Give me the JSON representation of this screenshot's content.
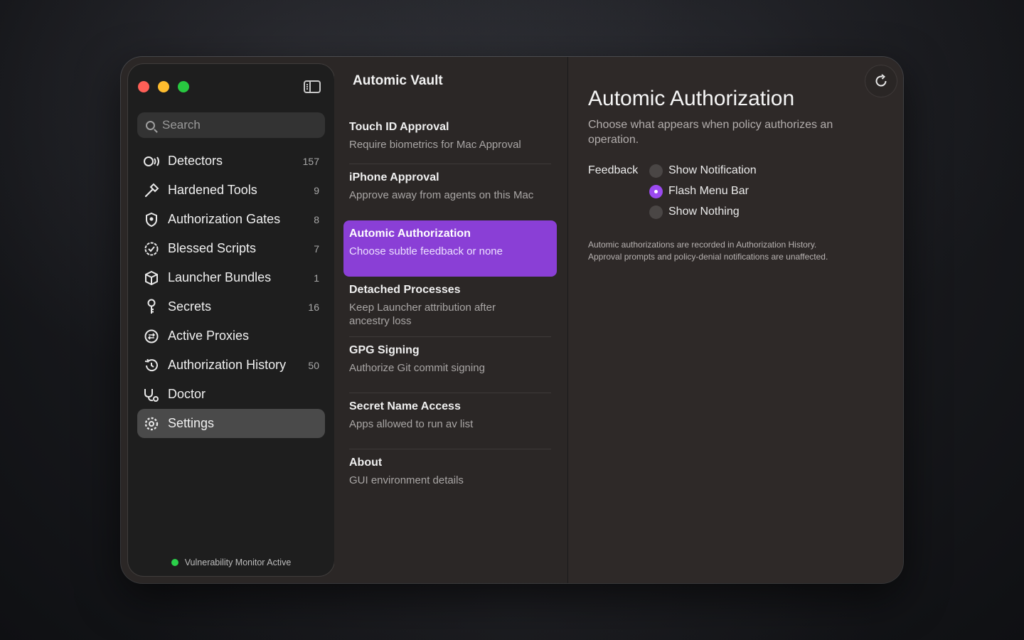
{
  "window": {
    "traffic_lights": [
      "close",
      "minimize",
      "zoom"
    ]
  },
  "sidebar": {
    "search_placeholder": "Search",
    "items": [
      {
        "label": "Detectors",
        "count": "157",
        "icon": "detector-icon"
      },
      {
        "label": "Hardened Tools",
        "count": "9",
        "icon": "hammer-icon"
      },
      {
        "label": "Authorization Gates",
        "count": "8",
        "icon": "shield-icon"
      },
      {
        "label": "Blessed Scripts",
        "count": "7",
        "icon": "seal-check-icon"
      },
      {
        "label": "Launcher Bundles",
        "count": "1",
        "icon": "cube-icon"
      },
      {
        "label": "Secrets",
        "count": "16",
        "icon": "key-icon"
      },
      {
        "label": "Active Proxies",
        "count": "",
        "icon": "proxy-icon"
      },
      {
        "label": "Authorization History",
        "count": "50",
        "icon": "history-icon"
      },
      {
        "label": "Doctor",
        "count": "",
        "icon": "stethoscope-icon"
      },
      {
        "label": "Settings",
        "count": "",
        "icon": "gear-icon"
      }
    ],
    "active_item": "Settings",
    "status": "Vulnerability Monitor Active",
    "status_color": "#2bd04a"
  },
  "middle": {
    "title": "Automic Vault",
    "items": [
      {
        "title": "Touch ID Approval",
        "subtitle": "Require biometrics for Mac Approval"
      },
      {
        "title": "iPhone Approval",
        "subtitle": "Approve away from agents on this Mac"
      },
      {
        "title": "Automic Authorization",
        "subtitle": "Choose subtle feedback or none"
      },
      {
        "title": "Detached Processes",
        "subtitle": "Keep Launcher attribution after ancestry loss"
      },
      {
        "title": "GPG Signing",
        "subtitle": "Authorize Git commit signing"
      },
      {
        "title": "Secret Name Access",
        "subtitle": "Apps allowed to run av list"
      },
      {
        "title": "About",
        "subtitle": "GUI environment details"
      }
    ],
    "active_item": "Automic Authorization",
    "accent": "#8a3fd6"
  },
  "detail": {
    "title": "Automic Authorization",
    "subtitle": "Choose what appears when policy authorizes an operation.",
    "feedback_label": "Feedback",
    "options": [
      "Show Notification",
      "Flash Menu Bar",
      "Show Nothing"
    ],
    "selected_option": "Flash Menu Bar",
    "note_line1": "Automic authorizations are recorded in Authorization History.",
    "note_line2": "Approval prompts and policy-denial notifications are unaffected."
  }
}
